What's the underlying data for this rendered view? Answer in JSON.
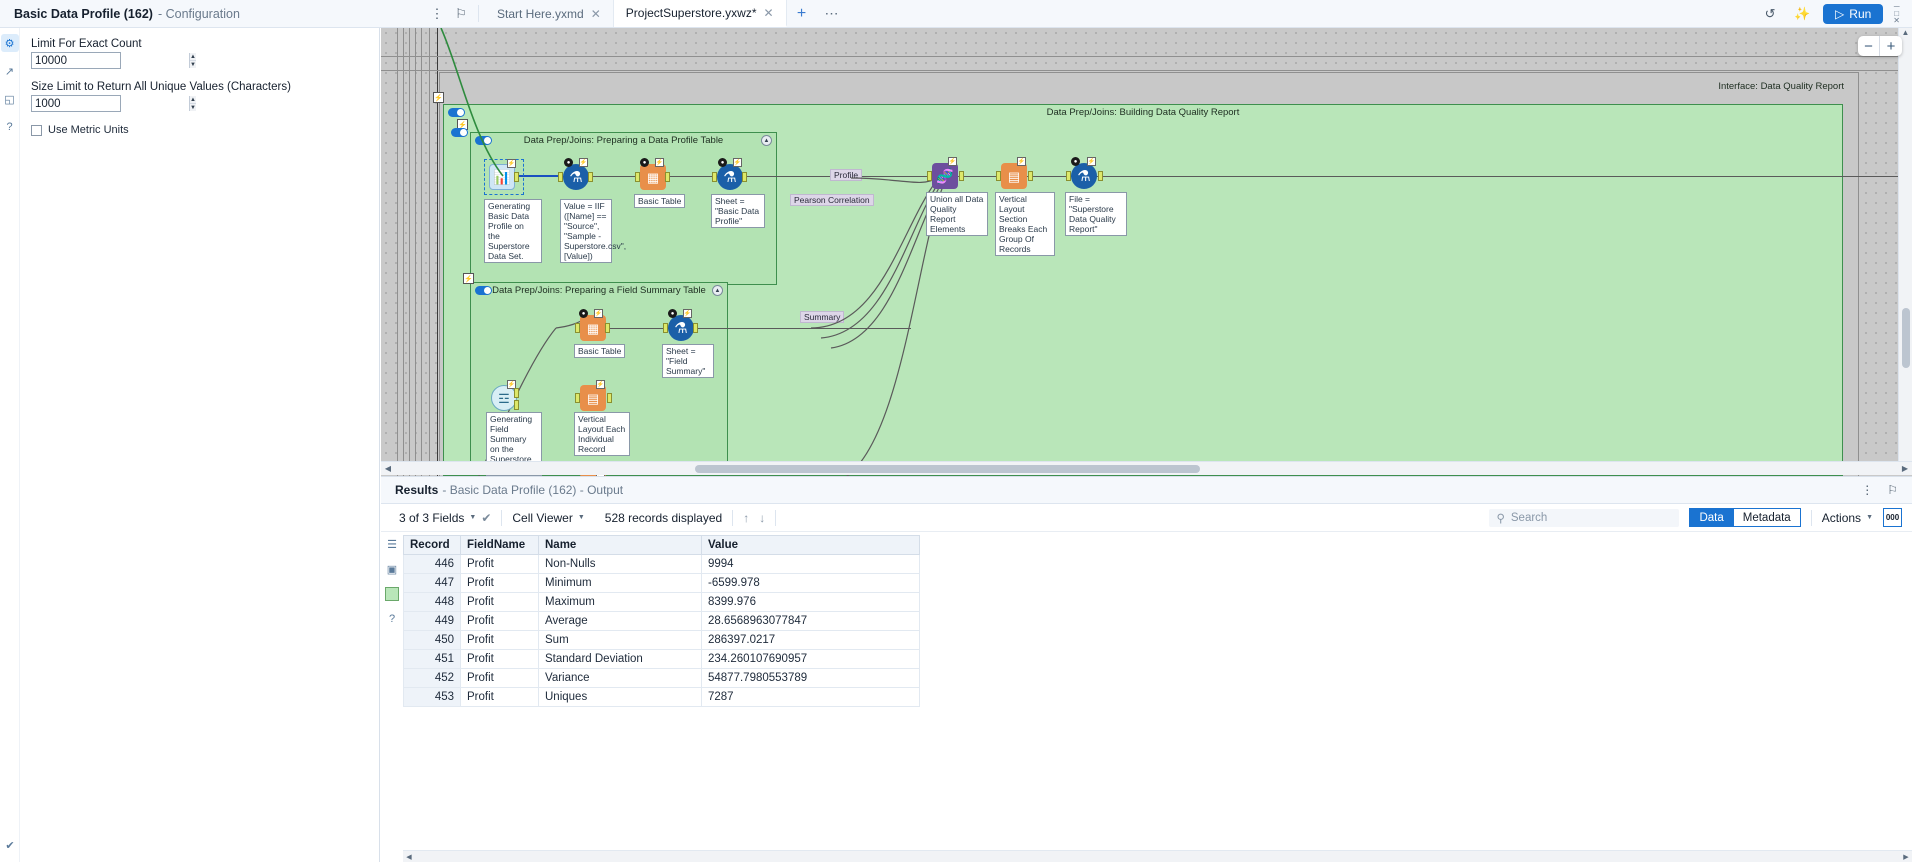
{
  "config": {
    "title_bold": "Basic Data Profile (162)",
    "title_dim": "- Configuration",
    "rail": [
      {
        "name": "gear-icon",
        "glyph": "⚙"
      },
      {
        "name": "arrow-circle-icon",
        "glyph": "↗"
      },
      {
        "name": "tag-icon",
        "glyph": "◱"
      },
      {
        "name": "help-icon",
        "glyph": "?"
      }
    ],
    "bottom_icon": "✔",
    "fields": [
      {
        "label": "Limit For Exact Count",
        "value": "10000"
      },
      {
        "label": "Size Limit to Return All Unique Values (Characters)",
        "value": "1000"
      }
    ],
    "checkbox_label": "Use Metric Units",
    "checkbox_checked": false
  },
  "topbar": {
    "more_icon": "⋮",
    "pin_icon": "⚐",
    "tabs": [
      {
        "label": "Start Here.yxmd",
        "active": false,
        "close": "✕"
      },
      {
        "label": "ProjectSuperstore.yxwz*",
        "active": true,
        "close": "✕"
      }
    ],
    "add_tab": "+",
    "overflow_tab": "⋯",
    "history_icon": "↺",
    "wand_icon": "✨",
    "run_label": "Run",
    "run_icon": "▷",
    "win_min": "─",
    "win_max": "□",
    "win_close": "✕"
  },
  "canvas": {
    "zoom_out": "−",
    "zoom_in": "+",
    "containers": [
      {
        "name": "interface-container",
        "title": "Interface: Data Quality Report"
      },
      {
        "name": "building-report-container",
        "title": "Data Prep/Joins: Building Data Quality Report"
      },
      {
        "name": "profile-table-container",
        "title": "Data Prep/Joins: Preparing a Data Profile Table"
      },
      {
        "name": "field-summary-container",
        "title": "Data Prep/Joins: Preparing a Field Summary Table"
      }
    ],
    "annotations": [
      "Generating Basic Data Profile on the Superstore Data Set.",
      "Value = IIF ([Name] == \"Source\", \"Sample - Superstore.csv\", [Value])",
      "Basic Table",
      "Sheet = \"Basic Data Profile\"",
      "Union all Data Quality Report Elements",
      "Vertical Layout Section Breaks Each Group Of Records",
      "File = \"Superstore Data Quality Report\"",
      "Basic Table",
      "Sheet = \"Field Summary\"",
      "Generating Field Summary on the Superstore Data Set.",
      "Vertical Layout Each Individual Record"
    ],
    "link_labels": [
      "Profile",
      "Pearson Correlation",
      "Summary"
    ],
    "collapse_glyph": "▲",
    "badge_glyph": "⚡"
  },
  "results": {
    "header_bold": "Results",
    "header_dim": "- Basic Data Profile (162) - Output",
    "more_icon": "⋮",
    "pin_icon": "⚐",
    "fields_label": "3 of 3 Fields",
    "check_icon": "✔",
    "cell_viewer_label": "Cell Viewer",
    "records_label": "528 records displayed",
    "up_icon": "↑",
    "down_icon": "↓",
    "search_placeholder": "Search",
    "search_icon": "⚲",
    "seg_data": "Data",
    "seg_metadata": "Metadata",
    "actions_label": "Actions",
    "zero_label": "000",
    "rail": [
      {
        "name": "list-view-icon",
        "glyph": "☰"
      },
      {
        "name": "layout-icon",
        "glyph": "▣"
      },
      {
        "name": "record-marker-icon",
        "glyph": ""
      },
      {
        "name": "help-icon",
        "glyph": "?"
      }
    ],
    "columns": [
      "Record",
      "FieldName",
      "Name",
      "Value"
    ],
    "rows": [
      [
        "446",
        "Profit",
        "Non-Nulls",
        "9994"
      ],
      [
        "447",
        "Profit",
        "Minimum",
        "-6599.978"
      ],
      [
        "448",
        "Profit",
        "Maximum",
        "8399.976"
      ],
      [
        "449",
        "Profit",
        "Average",
        "28.6568963077847"
      ],
      [
        "450",
        "Profit",
        "Sum",
        "286397.0217"
      ],
      [
        "451",
        "Profit",
        "Standard Deviation",
        "234.260107690957"
      ],
      [
        "452",
        "Profit",
        "Variance",
        "54877.7980553789"
      ],
      [
        "453",
        "Profit",
        "Uniques",
        "7287"
      ]
    ],
    "scroll_left": "◀",
    "scroll_right": "▶"
  },
  "colors": {
    "accent": "#1a73d1",
    "container_green": "#b9e6b9",
    "container_border": "#3e8f4e",
    "canvas_gray": "#c9c9c9"
  }
}
